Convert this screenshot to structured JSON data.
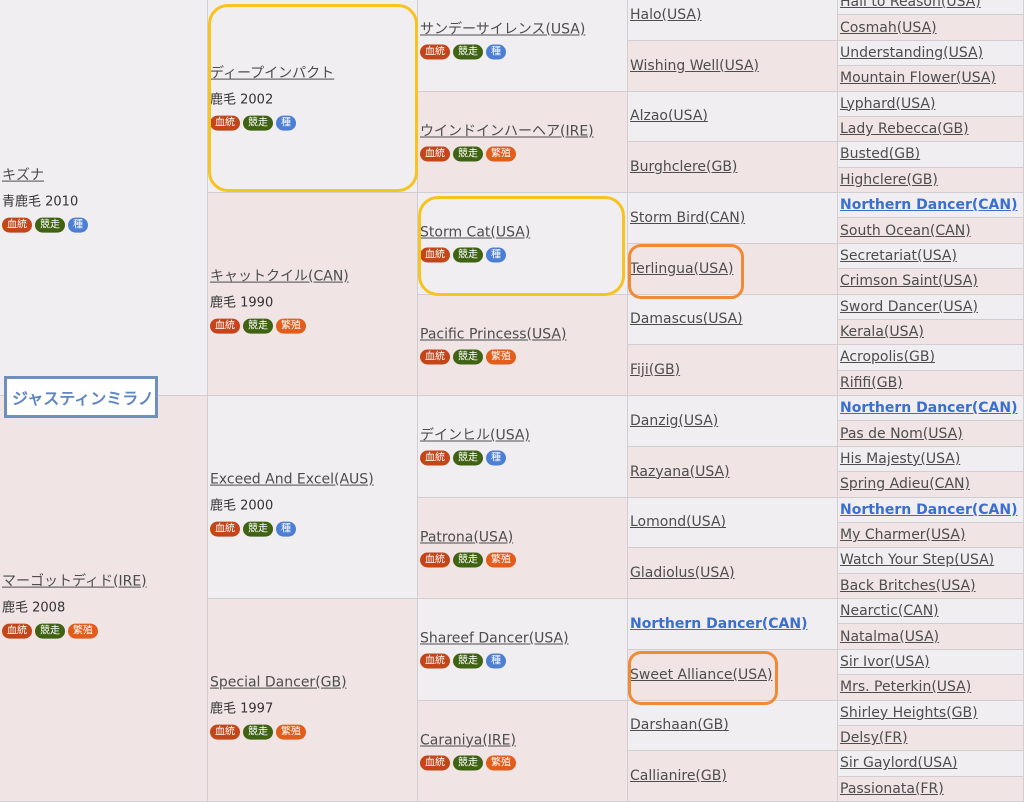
{
  "title": "ジャスティンミラノ",
  "badges": {
    "blood": "血統",
    "race": "競走",
    "seed": "種",
    "breed": "繁殖"
  },
  "gen1": [
    {
      "name": "キズナ",
      "coat": "青鹿毛 2010",
      "badges": [
        "blood",
        "race",
        "seed"
      ]
    },
    {
      "name": "マーゴットディド(IRE)",
      "coat": "鹿毛 2008",
      "badges": [
        "blood",
        "race",
        "breed"
      ]
    }
  ],
  "gen2": [
    {
      "name": "ディープインパクト",
      "coat": "鹿毛 2002",
      "badges": [
        "blood",
        "race",
        "seed"
      ]
    },
    {
      "name": "キャットクイル(CAN)",
      "coat": "鹿毛 1990",
      "badges": [
        "blood",
        "race",
        "breed"
      ]
    },
    {
      "name": "Exceed And Excel(AUS)",
      "coat": "鹿毛 2000",
      "badges": [
        "blood",
        "race",
        "seed"
      ]
    },
    {
      "name": "Special Dancer(GB)",
      "coat": "鹿毛 1997",
      "badges": [
        "blood",
        "race",
        "breed"
      ]
    }
  ],
  "gen3": [
    {
      "name": "サンデーサイレンス(USA)",
      "badges": [
        "blood",
        "race",
        "seed"
      ]
    },
    {
      "name": "ウインドインハーヘア(IRE)",
      "badges": [
        "blood",
        "race",
        "breed"
      ]
    },
    {
      "name": "Storm Cat(USA)",
      "badges": [
        "blood",
        "race",
        "seed"
      ]
    },
    {
      "name": "Pacific Princess(USA)",
      "badges": [
        "blood",
        "race",
        "breed"
      ]
    },
    {
      "name": "デインヒル(USA)",
      "badges": [
        "blood",
        "race",
        "seed"
      ]
    },
    {
      "name": "Patrona(USA)",
      "badges": [
        "blood",
        "race",
        "breed"
      ]
    },
    {
      "name": "Shareef Dancer(USA)",
      "badges": [
        "blood",
        "race",
        "seed"
      ]
    },
    {
      "name": "Caraniya(IRE)",
      "badges": [
        "blood",
        "race",
        "breed"
      ]
    }
  ],
  "gen4": [
    {
      "name": "Halo(USA)"
    },
    {
      "name": "Wishing Well(USA)"
    },
    {
      "name": "Alzao(USA)"
    },
    {
      "name": "Burghclere(GB)"
    },
    {
      "name": "Storm Bird(CAN)"
    },
    {
      "name": "Terlingua(USA)"
    },
    {
      "name": "Damascus(USA)"
    },
    {
      "name": "Fiji(GB)"
    },
    {
      "name": "Danzig(USA)"
    },
    {
      "name": "Razyana(USA)"
    },
    {
      "name": "Lomond(USA)"
    },
    {
      "name": "Gladiolus(USA)"
    },
    {
      "name": "Northern Dancer(CAN)",
      "bold": true
    },
    {
      "name": "Sweet Alliance(USA)"
    },
    {
      "name": "Darshaan(GB)"
    },
    {
      "name": "Callianire(GB)"
    }
  ],
  "gen5": [
    {
      "name": "Hail to Reason(USA)"
    },
    {
      "name": "Cosmah(USA)"
    },
    {
      "name": "Understanding(USA)"
    },
    {
      "name": "Mountain Flower(USA)"
    },
    {
      "name": "Lyphard(USA)"
    },
    {
      "name": "Lady Rebecca(GB)"
    },
    {
      "name": "Busted(GB)"
    },
    {
      "name": "Highclere(GB)"
    },
    {
      "name": "Northern Dancer(CAN)",
      "bold": true
    },
    {
      "name": "South Ocean(CAN)"
    },
    {
      "name": "Secretariat(USA)"
    },
    {
      "name": "Crimson Saint(USA)"
    },
    {
      "name": "Sword Dancer(USA)"
    },
    {
      "name": "Kerala(USA)"
    },
    {
      "name": "Acropolis(GB)"
    },
    {
      "name": "Rififi(GB)"
    },
    {
      "name": "Northern Dancer(CAN)",
      "bold": true
    },
    {
      "name": "Pas de Nom(USA)"
    },
    {
      "name": "His Majesty(USA)"
    },
    {
      "name": "Spring Adieu(CAN)"
    },
    {
      "name": "Northern Dancer(CAN)",
      "bold": true
    },
    {
      "name": "My Charmer(USA)"
    },
    {
      "name": "Watch Your Step(USA)"
    },
    {
      "name": "Back Britches(USA)"
    },
    {
      "name": "Nearctic(CAN)"
    },
    {
      "name": "Natalma(USA)"
    },
    {
      "name": "Sir Ivor(USA)"
    },
    {
      "name": "Mrs. Peterkin(USA)"
    },
    {
      "name": "Shirley Heights(GB)"
    },
    {
      "name": "Delsy(FR)"
    },
    {
      "name": "Sir Gaylord(USA)"
    },
    {
      "name": "Passionata(FR)"
    }
  ]
}
